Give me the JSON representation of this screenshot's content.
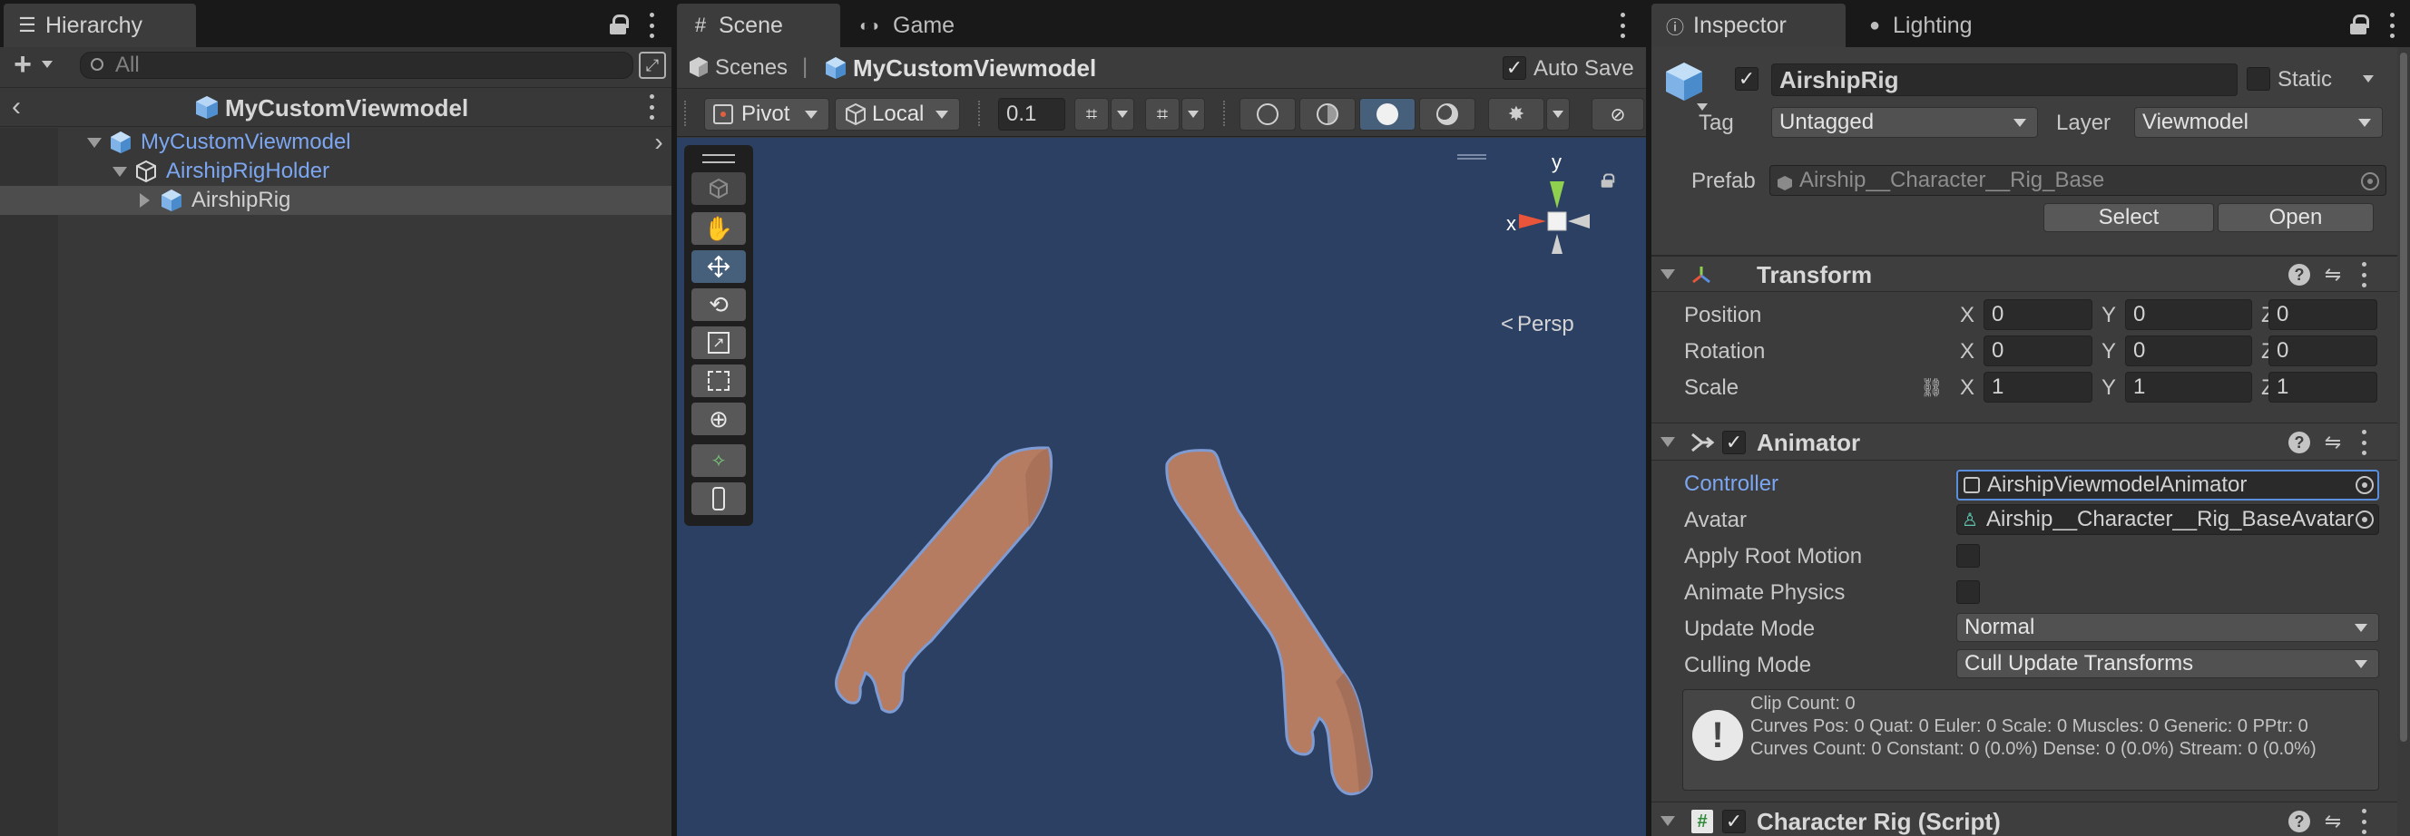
{
  "hierarchy": {
    "tab_label": "Hierarchy",
    "search_placeholder": "All",
    "scene_header": "MyCustomViewmodel",
    "items": [
      {
        "label": "MyCustomViewmodel"
      },
      {
        "label": "AirshipRigHolder"
      },
      {
        "label": "AirshipRig"
      }
    ]
  },
  "scene": {
    "tab_scene": "Scene",
    "tab_game": "Game",
    "breadcrumb_root": "Scenes",
    "breadcrumb_separator": "|",
    "breadcrumb_current": "MyCustomViewmodel",
    "auto_save_label": "Auto Save",
    "auto_save_checked": true,
    "pivot_label": "Pivot",
    "local_label": "Local",
    "snap_value": "0.1",
    "gizmo_y": "y",
    "gizmo_x": "x",
    "persp_label": "Persp",
    "background_color": "#2c4063",
    "arm_color": "#b67c62"
  },
  "inspector": {
    "tab_inspector": "Inspector",
    "tab_lighting": "Lighting",
    "object_name": "AirshipRig",
    "object_active": true,
    "static_label": "Static",
    "tag_label": "Tag",
    "tag_value": "Untagged",
    "layer_label": "Layer",
    "layer_value": "Viewmodel",
    "prefab_label": "Prefab",
    "prefab_value": "Airship__Character__Rig_Base",
    "select_button": "Select",
    "open_button": "Open",
    "transform": {
      "title": "Transform",
      "rows": [
        {
          "label": "Position",
          "x": "0",
          "y": "0",
          "z": "0"
        },
        {
          "label": "Rotation",
          "x": "0",
          "y": "0",
          "z": "0"
        },
        {
          "label": "Scale",
          "x": "1",
          "y": "1",
          "z": "1"
        }
      ],
      "axis_x": "X",
      "axis_y": "Y",
      "axis_z": "Z"
    },
    "animator": {
      "title": "Animator",
      "enabled": true,
      "controller_label": "Controller",
      "controller_value": "AirshipViewmodelAnimator",
      "avatar_label": "Avatar",
      "avatar_value": "Airship__Character__Rig_BaseAvatar",
      "apply_root_motion_label": "Apply Root Motion",
      "animate_physics_label": "Animate Physics",
      "update_mode_label": "Update Mode",
      "update_mode_value": "Normal",
      "culling_mode_label": "Culling Mode",
      "culling_mode_value": "Cull Update Transforms",
      "info_line1": "Clip Count: 0",
      "info_line2": "Curves Pos: 0 Quat: 0 Euler: 0 Scale: 0 Muscles: 0 Generic: 0 PPtr: 0",
      "info_line3": "Curves Count: 0 Constant: 0 (0.0%) Dense: 0 (0.0%) Stream: 0 (0.0%)"
    },
    "character_rig": {
      "title": "Character Rig (Script)",
      "enabled": true
    }
  },
  "colors": {
    "accent_blue": "#7ca6f0",
    "selected_tool": "#46607c",
    "selection_row": "#4d4d4d"
  }
}
